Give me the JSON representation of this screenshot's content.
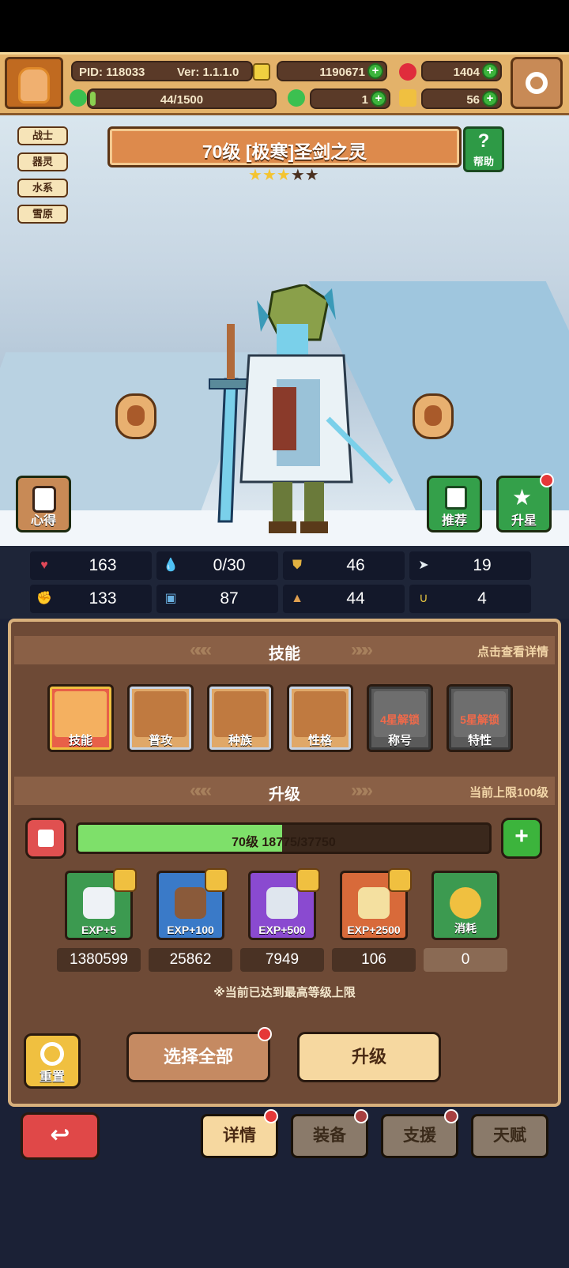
{
  "header": {
    "pid": "PID: 118033",
    "version": "Ver: 1.1.1.0",
    "gold": "1190671",
    "gems": "1404",
    "energy": "44/1500",
    "clover": "1",
    "key": "56",
    "energy_fraction": 0.029
  },
  "hero": {
    "tags": [
      "战士",
      "器灵",
      "水系",
      "雪原"
    ],
    "title": "70级 [极寒]圣剑之灵",
    "stars_filled": 3,
    "stars_total": 5,
    "help_label": "帮助",
    "left_button": "心得",
    "recommend_button": "推荐",
    "upstar_button": "升星"
  },
  "stats": [
    {
      "icon": "heart-icon",
      "value": "163"
    },
    {
      "icon": "water-drop-icon",
      "value": "0/30"
    },
    {
      "icon": "shield-icon",
      "value": "46"
    },
    {
      "icon": "wing-icon",
      "value": "19"
    },
    {
      "icon": "fist-icon",
      "value": "133"
    },
    {
      "icon": "book-icon",
      "value": "87"
    },
    {
      "icon": "boot-icon",
      "value": "44"
    },
    {
      "icon": "horseshoe-icon",
      "value": "4"
    }
  ],
  "skills_section": {
    "title": "技能",
    "hint": "点击查看详情",
    "items": [
      {
        "label": "技能",
        "lock": ""
      },
      {
        "label": "普攻",
        "lock": ""
      },
      {
        "label": "种族",
        "lock": ""
      },
      {
        "label": "性格",
        "lock": ""
      },
      {
        "label": "称号",
        "lock": "4星解锁"
      },
      {
        "label": "特性",
        "lock": "5星解锁"
      }
    ]
  },
  "level_section": {
    "title": "升级",
    "hint": "当前上限100级",
    "exp_text": "70级 18775/37750",
    "exp_fraction": 0.497,
    "items": [
      {
        "label": "EXP+5",
        "count": "1380599"
      },
      {
        "label": "EXP+100",
        "count": "25862"
      },
      {
        "label": "EXP+500",
        "count": "7949"
      },
      {
        "label": "EXP+2500",
        "count": "106"
      },
      {
        "label": "消耗",
        "count": "0"
      }
    ],
    "note": "※当前已达到最高等级上限"
  },
  "actions": {
    "reset": "重置",
    "select_all": "选择全部",
    "upgrade": "升级"
  },
  "tabs": [
    "详情",
    "装备",
    "支援",
    "天赋"
  ]
}
